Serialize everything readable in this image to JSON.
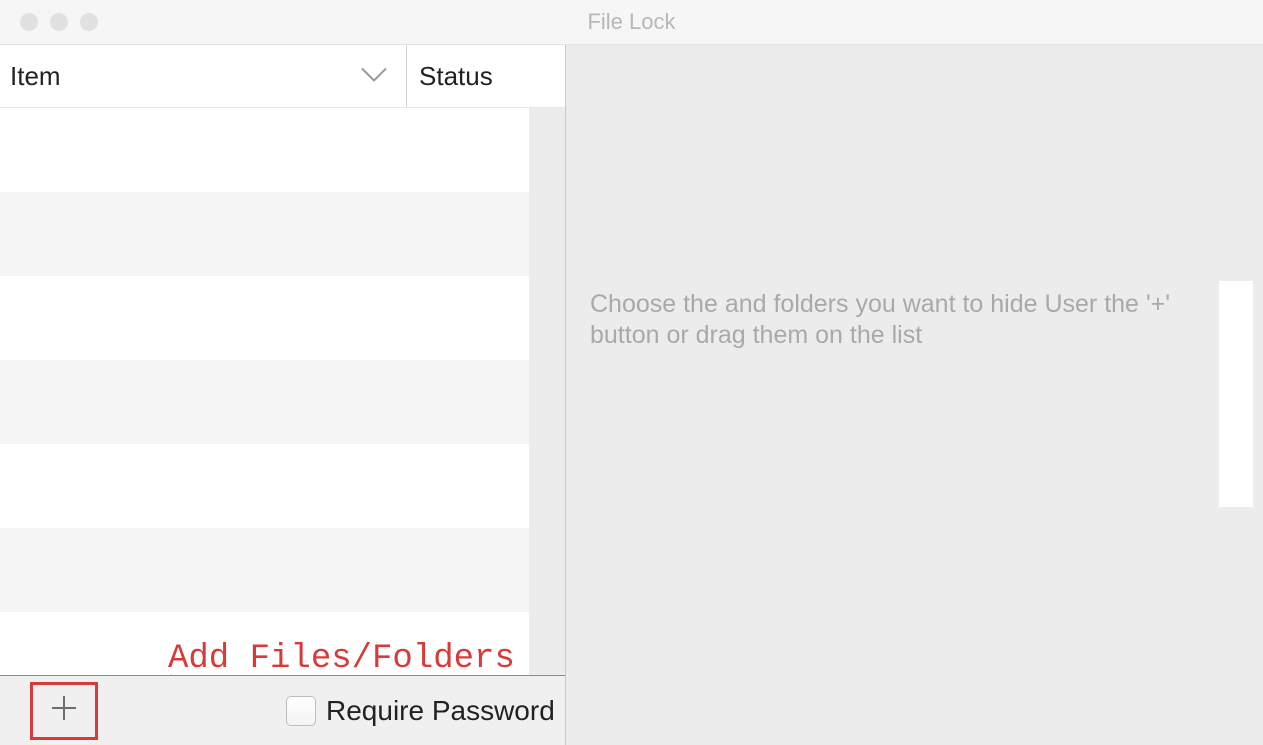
{
  "window": {
    "title": "File Lock"
  },
  "table": {
    "columns": {
      "item": "Item",
      "status": "Status"
    }
  },
  "bottombar": {
    "require_password_label": "Require Password"
  },
  "rightpane": {
    "hint": "Choose the and folders you want to hide User the '+' button or drag them on the list"
  },
  "annotation": {
    "add_label": "Add Files/Folders"
  }
}
